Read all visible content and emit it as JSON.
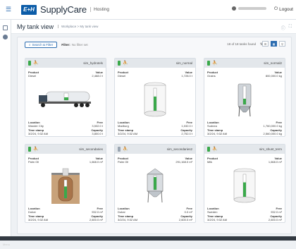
{
  "header": {
    "logo_text": "E+H",
    "app_name": "SupplyCare",
    "app_sub": "Hosting",
    "logout_label": "Logout"
  },
  "page": {
    "title": "My tank view",
    "breadcrumb": "Workplace > My tank view"
  },
  "filter": {
    "search_label": "Search & Filter",
    "filter_label": "Filter:",
    "filter_value": "No filter set",
    "found_text": "18 of 18 tanks found"
  },
  "labels": {
    "product": "Product",
    "value": "Value",
    "location": "Location",
    "free": "Free",
    "timestamp": "Time stamp",
    "capacity": "Capacity"
  },
  "tanks": [
    {
      "name": "sim_hydrotels",
      "product": "Diesel",
      "value": "2,468.0 t",
      "location": "Wander City",
      "free": "3,532.0 t",
      "timestamp": "3/2/24, 9:32 AM",
      "capacity": "3,800.0 t",
      "status": "ok",
      "shape": "trailer",
      "fill": 0.4
    },
    {
      "name": "sim_normal",
      "product": "Diesel",
      "value": "1,728.0 t",
      "location": "Madburg",
      "free": "1,032.0 t",
      "timestamp": "3/2/24, 9:32 AM",
      "capacity": "2,752.0 t",
      "status": "ok",
      "shape": "cylinder",
      "fill": 0.63
    },
    {
      "name": "sim_normal2",
      "product": "Grains",
      "value": "800,000.0 kg",
      "location": "Sudnea",
      "free": "1,760,000.0 kg",
      "timestamp": "3/2/24, 9:32 AM",
      "capacity": "2,560,000.0 kg",
      "status": "ok",
      "shape": "silo",
      "fill": 0.31
    },
    {
      "name": "sim_secondaries",
      "product": "Palm Oil",
      "value": "1,668.0 m³",
      "location": "Dubai",
      "free": "932.0 m³",
      "timestamp": "3/2/24, 9:32 AM",
      "capacity": "2,600.0 m³",
      "status": "ok",
      "shape": "underground",
      "fill": 0.64
    },
    {
      "name": "sim_secondaries2",
      "product": "Palm Oil",
      "value": "291,168.0 m³",
      "location": "Dubai",
      "free": "0.0 m³",
      "timestamp": "3/2/24, 9:32 AM",
      "capacity": "2,600.0 m³",
      "status": "grey",
      "shape": "hopper",
      "fill": 0.9
    },
    {
      "name": "sim_shunt_term",
      "product": "Milk",
      "value": "1,668.0 m³",
      "location": "Sweden",
      "free": "932.0 m³",
      "timestamp": "3/2/24, 9:32 AM",
      "capacity": "2,600.0 m³",
      "status": "ok",
      "shape": "cylinder",
      "fill": 0.64
    }
  ],
  "colors": {
    "accent": "#2b6cb0",
    "fill": "#3aa94a",
    "status_ok": "#3aa94a"
  },
  "footer": {
    "text": "Menu"
  }
}
